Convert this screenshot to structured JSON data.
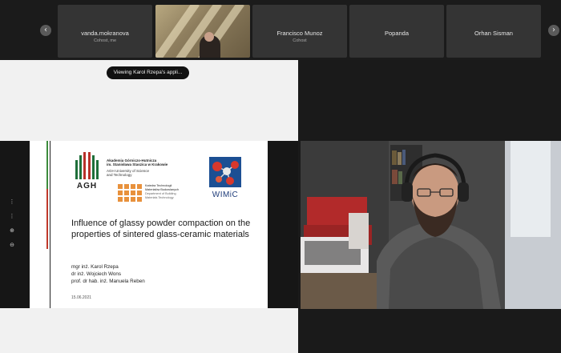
{
  "participants": [
    {
      "name": "vanda.mokranova",
      "subtitle": "Cohost, me",
      "video": false
    },
    {
      "name": "",
      "subtitle": "",
      "video": true
    },
    {
      "name": "Francisco Munoz",
      "subtitle": "Cohost",
      "video": false
    },
    {
      "name": "Popanda",
      "subtitle": "",
      "video": false
    },
    {
      "name": "Orhan Sisman",
      "subtitle": "",
      "video": false
    }
  ],
  "nav": {
    "prev_icon": "chevron-left-icon",
    "next_icon": "chevron-right-icon",
    "prev_glyph": "‹",
    "next_glyph": "›"
  },
  "share": {
    "viewing_label": "Viewing Karol Rzepa's appli..."
  },
  "side_tools": {
    "icons": [
      "more-icon",
      "more-icon",
      "zoom-in-icon",
      "zoom-out-icon"
    ],
    "glyphs": [
      "⋮",
      "⋮",
      "⊕",
      "⊖"
    ]
  },
  "slide": {
    "agh": "AGH",
    "uni_line1": "Akademia Górniczo-Hutnicza",
    "uni_line2": "im. Stanisława Staszica w Krakowie",
    "uni_line3": "AGH University of Science",
    "uni_line4": "and Technology",
    "dept_line1": "Katedra Technologii",
    "dept_line2": "Materiałów Budowlanych",
    "dept_line3": "Department of Building",
    "dept_line4": "Materials Technology",
    "wimic": "WIMiC",
    "title": "Influence of glassy powder compaction on the properties of sintered glass-ceramic materials",
    "authors": [
      "mgr inż. Karol Rzepa",
      "dr inż. Wojciech Wons",
      "prof. dr hab. inż. Manuela Reben"
    ],
    "date": "15.06.2021"
  },
  "colors": {
    "agh_green": "#1f6f3a",
    "agh_red": "#c0392b",
    "dept_orange": "#e8913c",
    "wimic_blue": "#1c4f93"
  }
}
